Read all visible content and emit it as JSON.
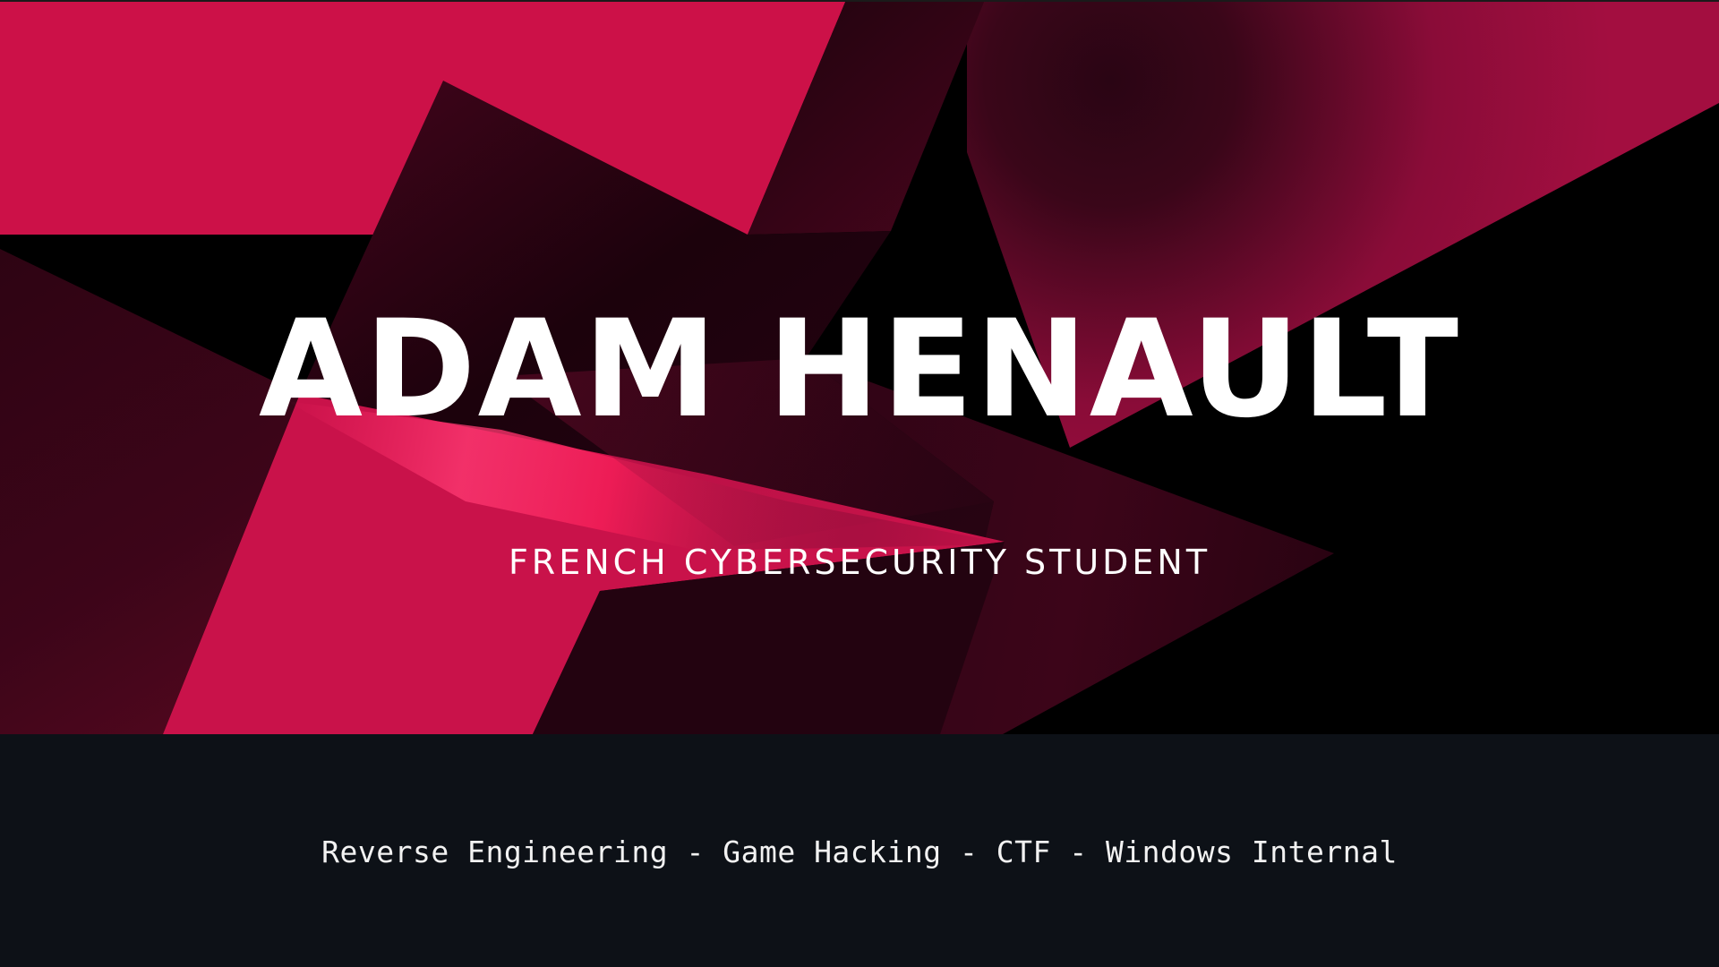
{
  "hero": {
    "title": "ADAM HENAULT",
    "subtitle": "FRENCH CYBERSECURITY STUDENT"
  },
  "footer": {
    "tagline": "Reverse Engineering - Game Hacking - CTF - Windows Internal"
  },
  "colors": {
    "accent": "#cc1148",
    "accent_dark": "#8a0c38",
    "shadow": "#1f0412",
    "footer_bg": "#0d1117",
    "text": "#ffffff"
  }
}
